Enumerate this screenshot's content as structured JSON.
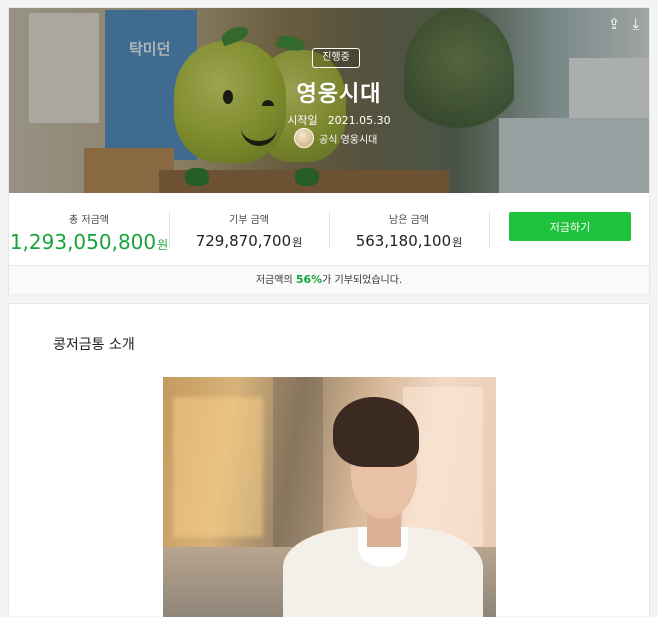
{
  "hero": {
    "poster_text": "탁미던",
    "badge": "진행중",
    "title": "영웅시대",
    "start_label": "시작일",
    "start_date": "2021.05.30",
    "owner_name": "공식 영웅시대",
    "icons": [
      "share-icon",
      "download-icon"
    ]
  },
  "stats": {
    "total": {
      "label": "총 저금액",
      "value": "1,293,050,800",
      "unit": "원"
    },
    "donated": {
      "label": "기부 금액",
      "value": "729,870,700",
      "unit": "원"
    },
    "remaining": {
      "label": "남은 금액",
      "value": "563,180,100",
      "unit": "원"
    },
    "save_button": "저금하기"
  },
  "notice": {
    "prefix": "저금액의 ",
    "percent": "56%",
    "suffix": "가 기부되었습니다."
  },
  "intro": {
    "title": "콩저금통 소개"
  },
  "colors": {
    "accent": "#1fc23b",
    "accent_text": "#16a53a"
  }
}
